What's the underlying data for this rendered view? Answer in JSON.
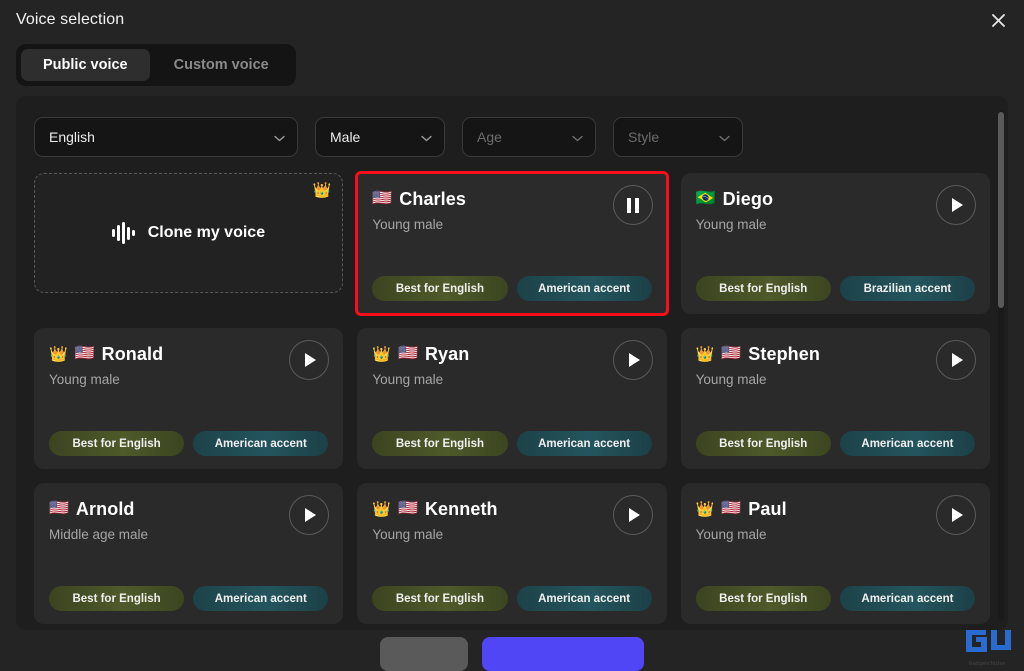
{
  "header": {
    "title": "Voice selection",
    "close_icon": "close-icon"
  },
  "tabs": [
    {
      "label": "Public voice",
      "active": true
    },
    {
      "label": "Custom voice",
      "active": false
    }
  ],
  "filters": [
    {
      "name": "language",
      "value": "English",
      "is_placeholder": false,
      "icon": "chevron-down-icon"
    },
    {
      "name": "gender",
      "value": "Male",
      "is_placeholder": false,
      "icon": "chevron-down-icon"
    },
    {
      "name": "age",
      "value": "Age",
      "is_placeholder": true,
      "icon": "chevron-down-icon"
    },
    {
      "name": "style",
      "value": "Style",
      "is_placeholder": true,
      "icon": "chevron-down-icon"
    }
  ],
  "clone_card": {
    "label": "Clone my voice",
    "crown": "👑",
    "icon": "waveform-icon"
  },
  "voices": [
    {
      "name": "Charles",
      "flag": "🇺🇸",
      "crown": "",
      "subtitle": "Young male",
      "selected": true,
      "playing": true,
      "tags": [
        {
          "label": "Best for English",
          "style": "green"
        },
        {
          "label": "American accent",
          "style": "teal"
        }
      ]
    },
    {
      "name": "Diego",
      "flag": "🇧🇷",
      "crown": "",
      "subtitle": "Young male",
      "selected": false,
      "playing": false,
      "tags": [
        {
          "label": "Best for English",
          "style": "green"
        },
        {
          "label": "Brazilian accent",
          "style": "teal"
        }
      ]
    },
    {
      "name": "Ronald",
      "flag": "🇺🇸",
      "crown": "👑",
      "subtitle": "Young male",
      "selected": false,
      "playing": false,
      "tags": [
        {
          "label": "Best for English",
          "style": "green"
        },
        {
          "label": "American accent",
          "style": "teal"
        }
      ]
    },
    {
      "name": "Ryan",
      "flag": "🇺🇸",
      "crown": "👑",
      "subtitle": "Young male",
      "selected": false,
      "playing": false,
      "tags": [
        {
          "label": "Best for English",
          "style": "green"
        },
        {
          "label": "American accent",
          "style": "teal"
        }
      ]
    },
    {
      "name": "Stephen",
      "flag": "🇺🇸",
      "crown": "👑",
      "subtitle": "Young male",
      "selected": false,
      "playing": false,
      "tags": [
        {
          "label": "Best for English",
          "style": "green"
        },
        {
          "label": "American accent",
          "style": "teal"
        }
      ]
    },
    {
      "name": "Arnold",
      "flag": "🇺🇸",
      "crown": "",
      "subtitle": "Middle age male",
      "selected": false,
      "playing": false,
      "tags": [
        {
          "label": "Best for English",
          "style": "green"
        },
        {
          "label": "American accent",
          "style": "teal"
        }
      ]
    },
    {
      "name": "Kenneth",
      "flag": "🇺🇸",
      "crown": "👑",
      "subtitle": "Young male",
      "selected": false,
      "playing": false,
      "tags": [
        {
          "label": "Best for English",
          "style": "green"
        },
        {
          "label": "American accent",
          "style": "teal"
        }
      ]
    },
    {
      "name": "Paul",
      "flag": "🇺🇸",
      "crown": "👑",
      "subtitle": "Young male",
      "selected": false,
      "playing": false,
      "tags": [
        {
          "label": "Best for English",
          "style": "green"
        },
        {
          "label": "American accent",
          "style": "teal"
        }
      ]
    }
  ],
  "footer": {
    "cancel_label": "",
    "confirm_label": ""
  },
  "watermark": {
    "text": "GadgetsToUse",
    "color": "#2a6fdb"
  },
  "colors": {
    "modal_bg": "#242424",
    "panel_bg": "#1e1e1e",
    "card_bg": "#2a2a2a",
    "selection_outline": "#fc0d1b",
    "confirm_button": "#5146f5",
    "tag_green": "#4e5a2a",
    "tag_teal": "#24555e"
  }
}
